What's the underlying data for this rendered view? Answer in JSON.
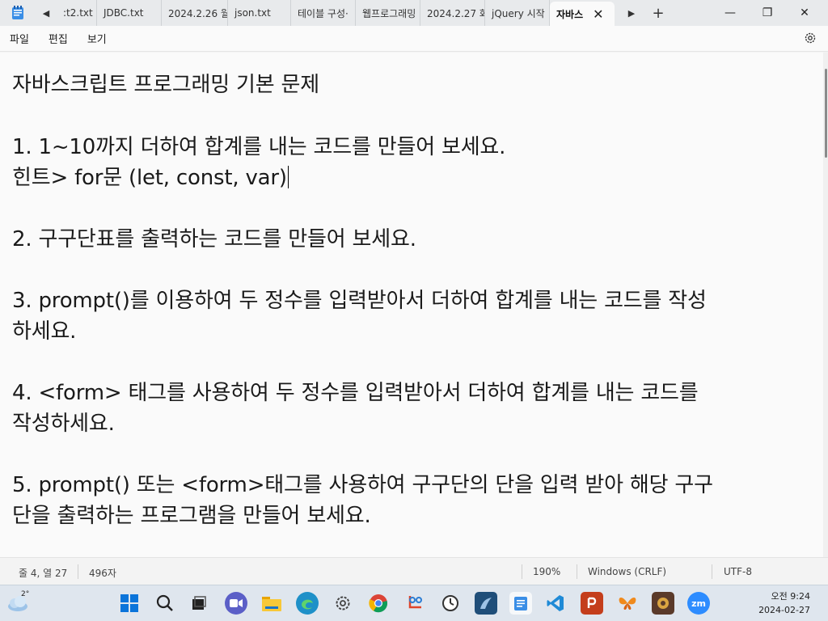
{
  "tabs": [
    {
      "label": ":t2.txt"
    },
    {
      "label": "JDBC.txt"
    },
    {
      "label": "2024.2.26 월"
    },
    {
      "label": "json.txt"
    },
    {
      "label": "테이블 구성·"
    },
    {
      "label": "웹프로그래밍"
    },
    {
      "label": "2024.2.27 화"
    },
    {
      "label": "jQuery 시작"
    },
    {
      "label": "자바스"
    }
  ],
  "window": {
    "close_tab": "✕",
    "new_tab": "+",
    "minimize": "—",
    "restore": "❐",
    "close": "✕"
  },
  "menu": {
    "file": "파일",
    "edit": "편집",
    "view": "보기"
  },
  "editor": {
    "lines": [
      "자바스크립트 프로그래밍 기본 문제",
      "1. 1~10까지 더하여 합계를 내는 코드를 만들어 보세요.",
      "힌트> for문 (let, const, var)",
      "2. 구구단표를 출력하는 코드를 만들어 보세요.",
      "3. prompt()를 이용하여 두 정수를 입력받아서 더하여 합계를 내는 코드를 작성",
      "하세요.",
      "4. <form> 태그를 사용하여 두 정수를 입력받아서 더하여 합계를 내는 코드를",
      "작성하세요.",
      "5. prompt() 또는 <form>태그를 사용하여 구구단의 단을 입력 받아 해당 구구",
      "단을 출력하는 프로그램을 만들어 보세요."
    ]
  },
  "status": {
    "position": "줄 4, 열 27",
    "chars": "496자",
    "zoom": "190%",
    "line_ending": "Windows (CRLF)",
    "encoding": "UTF-8"
  },
  "taskbar": {
    "temperature": "2°",
    "time": "오전 9:24",
    "date": "2024-02-27"
  },
  "colors": {
    "accent": "#0067c0",
    "editor_bg": "#fafafa"
  }
}
